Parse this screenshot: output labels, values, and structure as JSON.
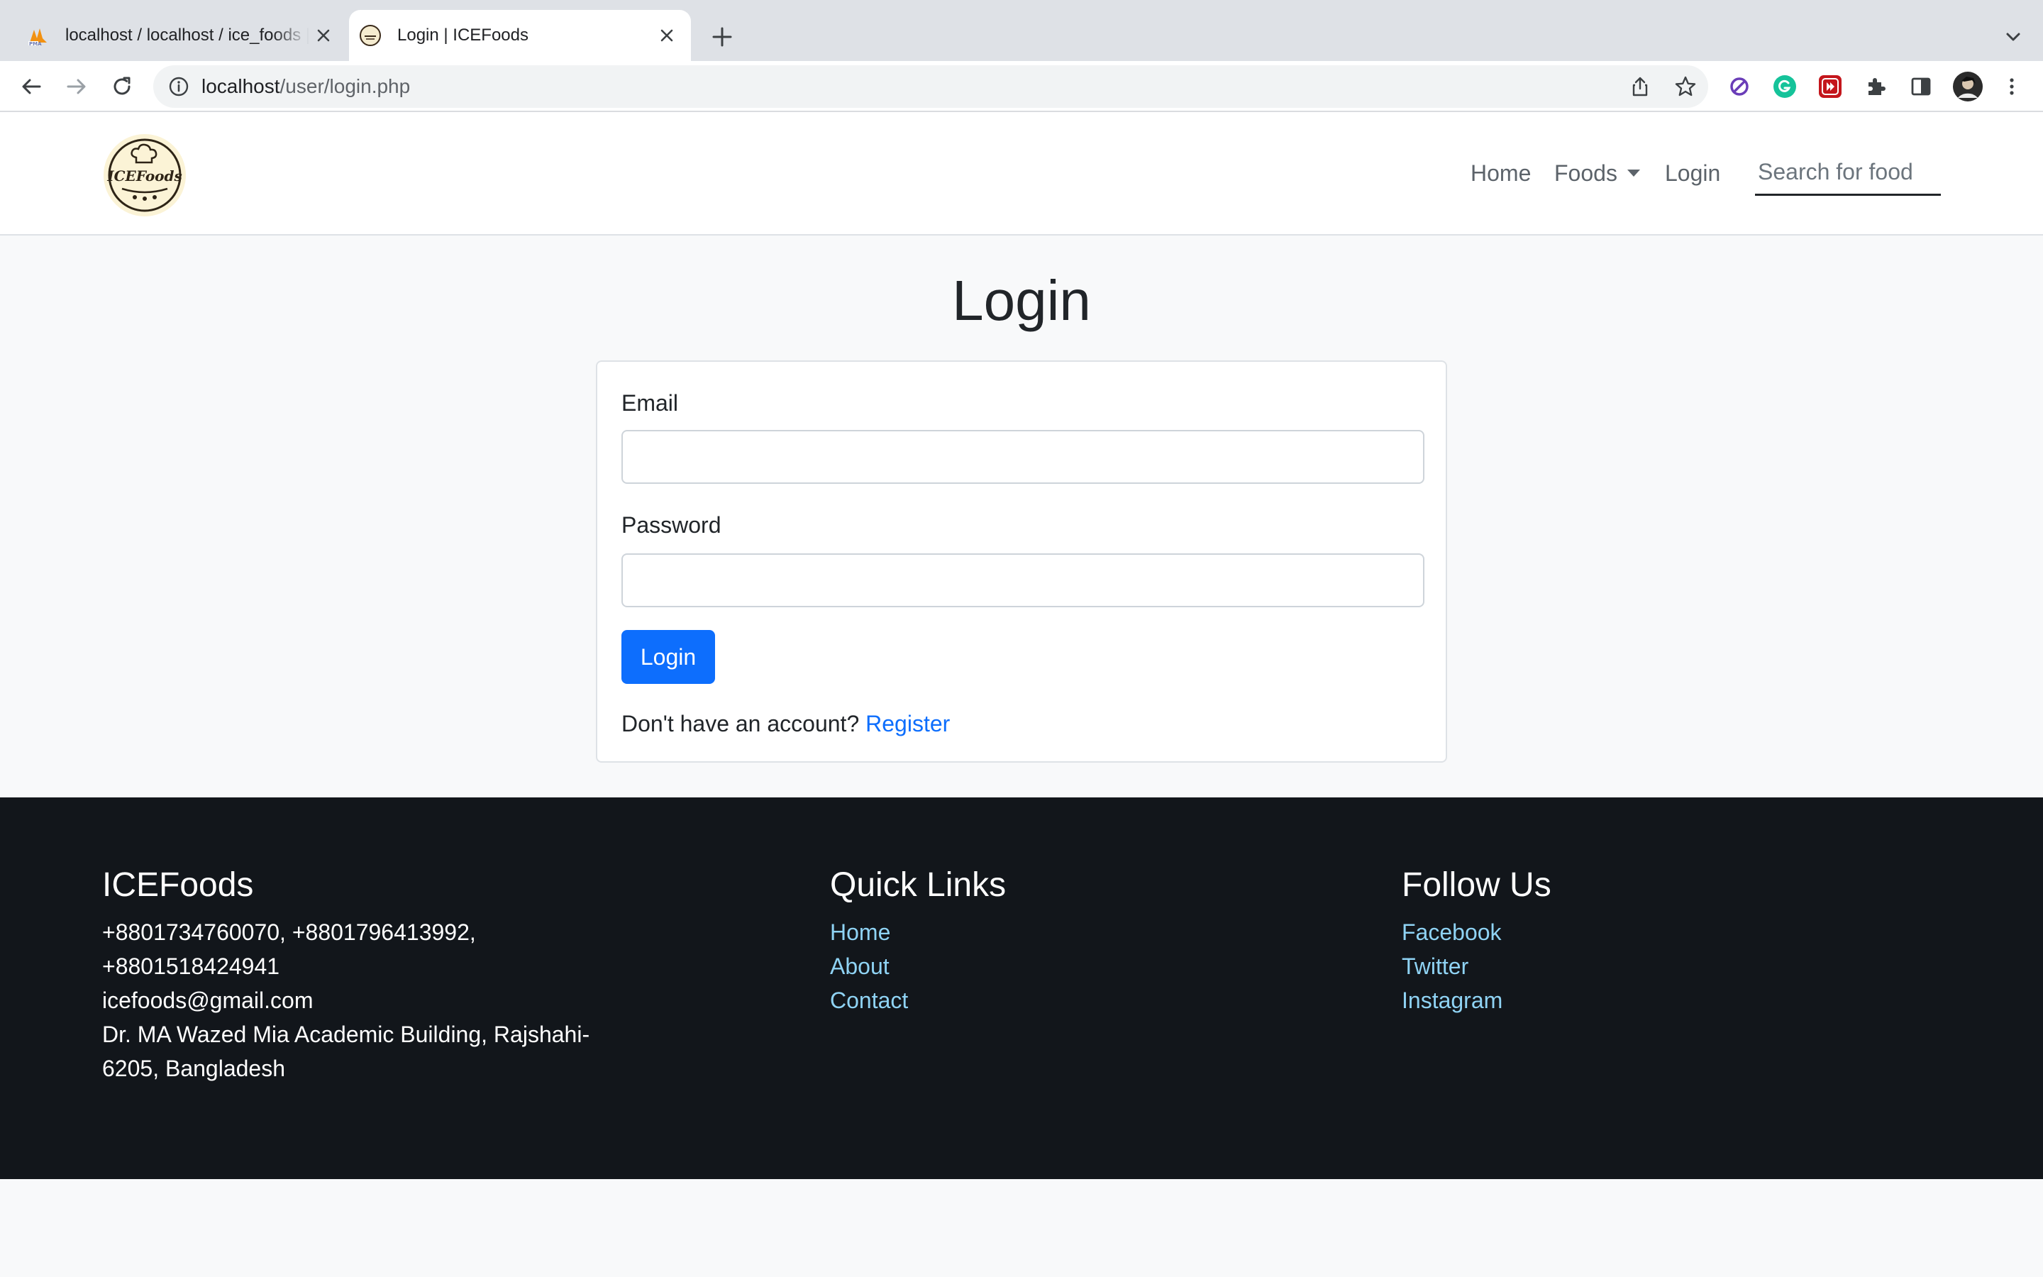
{
  "browser": {
    "tabs": [
      {
        "title": "localhost / localhost / ice_foods | phpMyAdmin",
        "active": false
      },
      {
        "title": "Login | ICEFoods",
        "active": true
      }
    ],
    "url": {
      "host": "localhost",
      "path": "/user/login.php"
    },
    "icons": [
      "back-icon",
      "forward-icon",
      "reload-icon",
      "info-icon",
      "share-icon",
      "star-icon",
      "extensions-icon",
      "side-panel-icon",
      "menu-icon"
    ]
  },
  "nav": {
    "logo_text": "ICEFoods",
    "home": "Home",
    "foods": "Foods",
    "login": "Login",
    "search_placeholder": "Search for food"
  },
  "login_form": {
    "title": "Login",
    "email_label": "Email",
    "email_value": "",
    "password_label": "Password",
    "password_value": "",
    "submit_label": "Login",
    "register_prompt": "Don't have an account?",
    "register_link": "Register"
  },
  "footer": {
    "brand": {
      "heading": "ICEFoods",
      "phones_line1": "+8801734760070, +8801796413992,",
      "phones_line2": "+8801518424941",
      "email": "icefoods@gmail.com",
      "address_line1": "Dr. MA Wazed Mia Academic Building, Rajshahi-",
      "address_line2": "6205, Bangladesh"
    },
    "quick_links": {
      "heading": "Quick Links",
      "items": [
        "Home",
        "About",
        "Contact"
      ]
    },
    "follow_us": {
      "heading": "Follow Us",
      "items": [
        "Facebook",
        "Twitter",
        "Instagram"
      ]
    }
  },
  "colors": {
    "primary": "#0d6efd",
    "footer_bg": "#12161b",
    "footer_link": "#8fd3f4",
    "page_bg": "#f8f9fa"
  }
}
